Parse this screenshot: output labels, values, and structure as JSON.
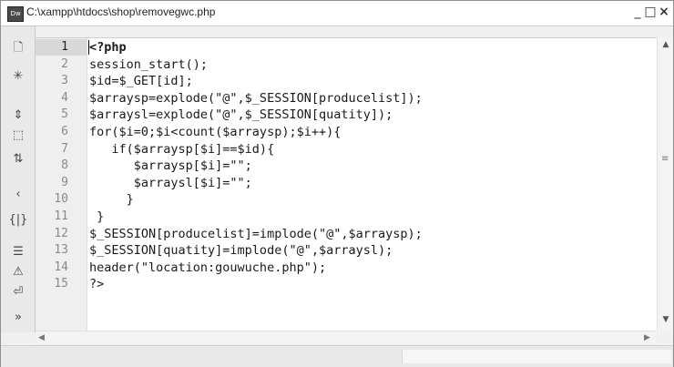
{
  "window": {
    "icon_label": "Dw",
    "title": "C:\\xampp\\htdocs\\shop\\removegwc.php",
    "controls": {
      "minimize": "_",
      "maximize": "□",
      "close": "×"
    }
  },
  "toolbar": {
    "icons": [
      {
        "name": "open-documents-icon",
        "glyph": "🗋"
      },
      {
        "name": "file-management-icon",
        "glyph": "✳"
      },
      {
        "name": "expand-all-icon",
        "glyph": "⇕"
      },
      {
        "name": "select-parent-tag-icon",
        "glyph": "⬚"
      },
      {
        "name": "balance-braces-icon",
        "glyph": "⇅"
      },
      {
        "name": "apply-source-formatting-icon",
        "glyph": "‹"
      },
      {
        "name": "code-hints-icon",
        "glyph": "{|}"
      },
      {
        "name": "line-numbers-icon",
        "glyph": "☰"
      },
      {
        "name": "highlight-invalid-icon",
        "glyph": "⚠"
      },
      {
        "name": "word-wrap-icon",
        "glyph": "⏎"
      },
      {
        "name": "more-tools-icon",
        "glyph": "»"
      }
    ]
  },
  "editor": {
    "active_line": 1,
    "lines": [
      {
        "num": "1",
        "text": "<?php",
        "bold": true
      },
      {
        "num": "2",
        "text": "session_start();"
      },
      {
        "num": "3",
        "text": "$id=$_GET[id];"
      },
      {
        "num": "4",
        "text": "$arraysp=explode(\"@\",$_SESSION[producelist]);"
      },
      {
        "num": "5",
        "text": "$arraysl=explode(\"@\",$_SESSION[quatity]);"
      },
      {
        "num": "6",
        "text": "for($i=0;$i<count($arraysp);$i++){"
      },
      {
        "num": "7",
        "text": "   if($arraysp[$i]==$id){"
      },
      {
        "num": "8",
        "text": "      $arraysp[$i]=\"\";"
      },
      {
        "num": "9",
        "text": "      $arraysl[$i]=\"\";"
      },
      {
        "num": "10",
        "text": "     }"
      },
      {
        "num": "11",
        "text": " }"
      },
      {
        "num": "12",
        "text": "$_SESSION[producelist]=implode(\"@\",$arraysp);"
      },
      {
        "num": "13",
        "text": "$_SESSION[quatity]=implode(\"@\",$arraysl);"
      },
      {
        "num": "14",
        "text": "header(\"location:gouwuche.php\");"
      },
      {
        "num": "15",
        "text": "?>"
      }
    ]
  },
  "scrollbars": {
    "up": "▲",
    "down": "▼",
    "grip": "≡",
    "left": "◀",
    "right": "▶"
  }
}
